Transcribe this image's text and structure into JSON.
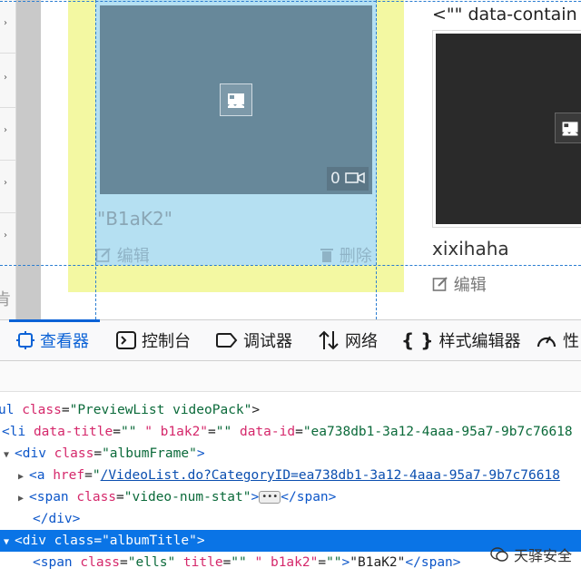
{
  "page": {
    "card1": {
      "video_count": "0",
      "title": "\"B1aK2\"",
      "edit_label": "编辑",
      "delete_label": "删除"
    },
    "card2_header": "<\"\" data-contain",
    "card2": {
      "title": "xixihaha",
      "edit_label": "编辑"
    },
    "left_partial_char": "肯"
  },
  "devtools": {
    "tabs": [
      {
        "label": "查看器",
        "icon": "inspector-icon"
      },
      {
        "label": "控制台",
        "icon": "console-icon"
      },
      {
        "label": "调试器",
        "icon": "debugger-icon"
      },
      {
        "label": "网络",
        "icon": "network-icon"
      },
      {
        "label": "样式编辑器",
        "icon": "style-editor-icon"
      },
      {
        "label": "性",
        "icon": "performance-icon"
      }
    ],
    "tree": {
      "r1": {
        "tag": "ul",
        "attr": "class",
        "val": "PreviewList videoPack"
      },
      "r2": {
        "tag": "li",
        "attr1": "data-title",
        "val1": "\" b1ak2\"",
        "mid": "\"\"",
        "attr2": "data-id",
        "val2": "ea738db1-3a12-4aaa-95a7-9b7c76618"
      },
      "r3": {
        "tag": "div",
        "attr": "class",
        "val": "albumFrame"
      },
      "r4": {
        "tag": "a",
        "attr": "href",
        "val": "/VideoList.do?CategoryID=ea738db1-3a12-4aaa-95a7-9b7c76618"
      },
      "r5": {
        "tag": "span",
        "attr": "class",
        "val": "video-num-stat",
        "close": "span"
      },
      "r6": {
        "close": "div"
      },
      "r7": {
        "tag": "div",
        "attr": "class",
        "val": "albumTitle"
      },
      "r8": {
        "tag": "span",
        "attr1": "class",
        "val1": "ells",
        "attr2": "title",
        "val2": "\" b1ak2\"",
        "mid": "\"\"",
        "text": "\"B1aK2\"",
        "close": "span"
      }
    }
  },
  "watermark": "天驿安全",
  "colors": {
    "accent": "#0a74e6",
    "margin_highlight": "#f3f8a2",
    "content_highlight": "#b5e0f2"
  }
}
